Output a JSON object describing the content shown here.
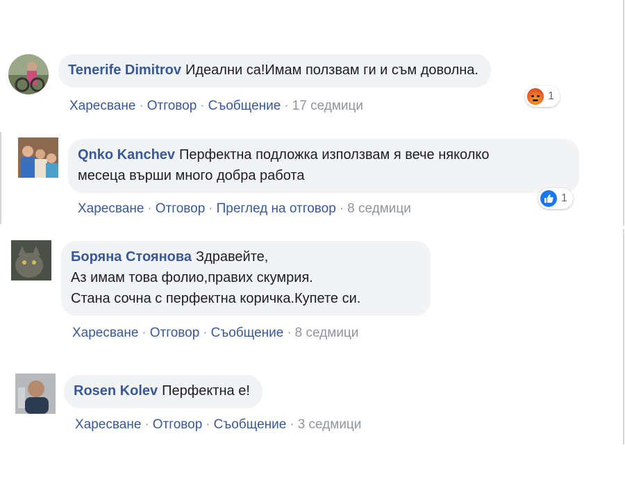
{
  "comments": [
    {
      "author": "Tenerife Dimitrov",
      "text_lines": [
        "Идеални са!Имам ползвам ги и съм доволна."
      ],
      "actions": [
        "Харесване",
        "Отговор",
        "Съобщение"
      ],
      "time": "17 седмици",
      "reaction": {
        "type": "angry",
        "count": "1"
      }
    },
    {
      "author": "Qnko Kanchev",
      "text_lines": [
        "Перфектна подложка използвам я вече няколко",
        "месеца върши много добра работа"
      ],
      "actions": [
        "Харесване",
        "Отговор",
        "Преглед на отговор"
      ],
      "time": "8 седмици",
      "reaction": {
        "type": "like",
        "count": "1"
      }
    },
    {
      "author": "Боряна Стоянова",
      "text_lines": [
        "Здравейте,",
        "Аз имам това фолио,правих скумрия.",
        "Стана сочна с перфектна коричка.Купете си."
      ],
      "actions": [
        "Харесване",
        "Отговор",
        "Съобщение"
      ],
      "time": "8 седмици"
    },
    {
      "author": "Rosen Kolev",
      "text_lines": [
        "Перфектна е!"
      ],
      "actions": [
        "Харесване",
        "Отговор",
        "Съобщение"
      ],
      "time": "3 седмици"
    }
  ],
  "separator": "·",
  "colors": {
    "name": "#385898",
    "bubble": "#f2f3f5",
    "meta": "#90949c"
  }
}
